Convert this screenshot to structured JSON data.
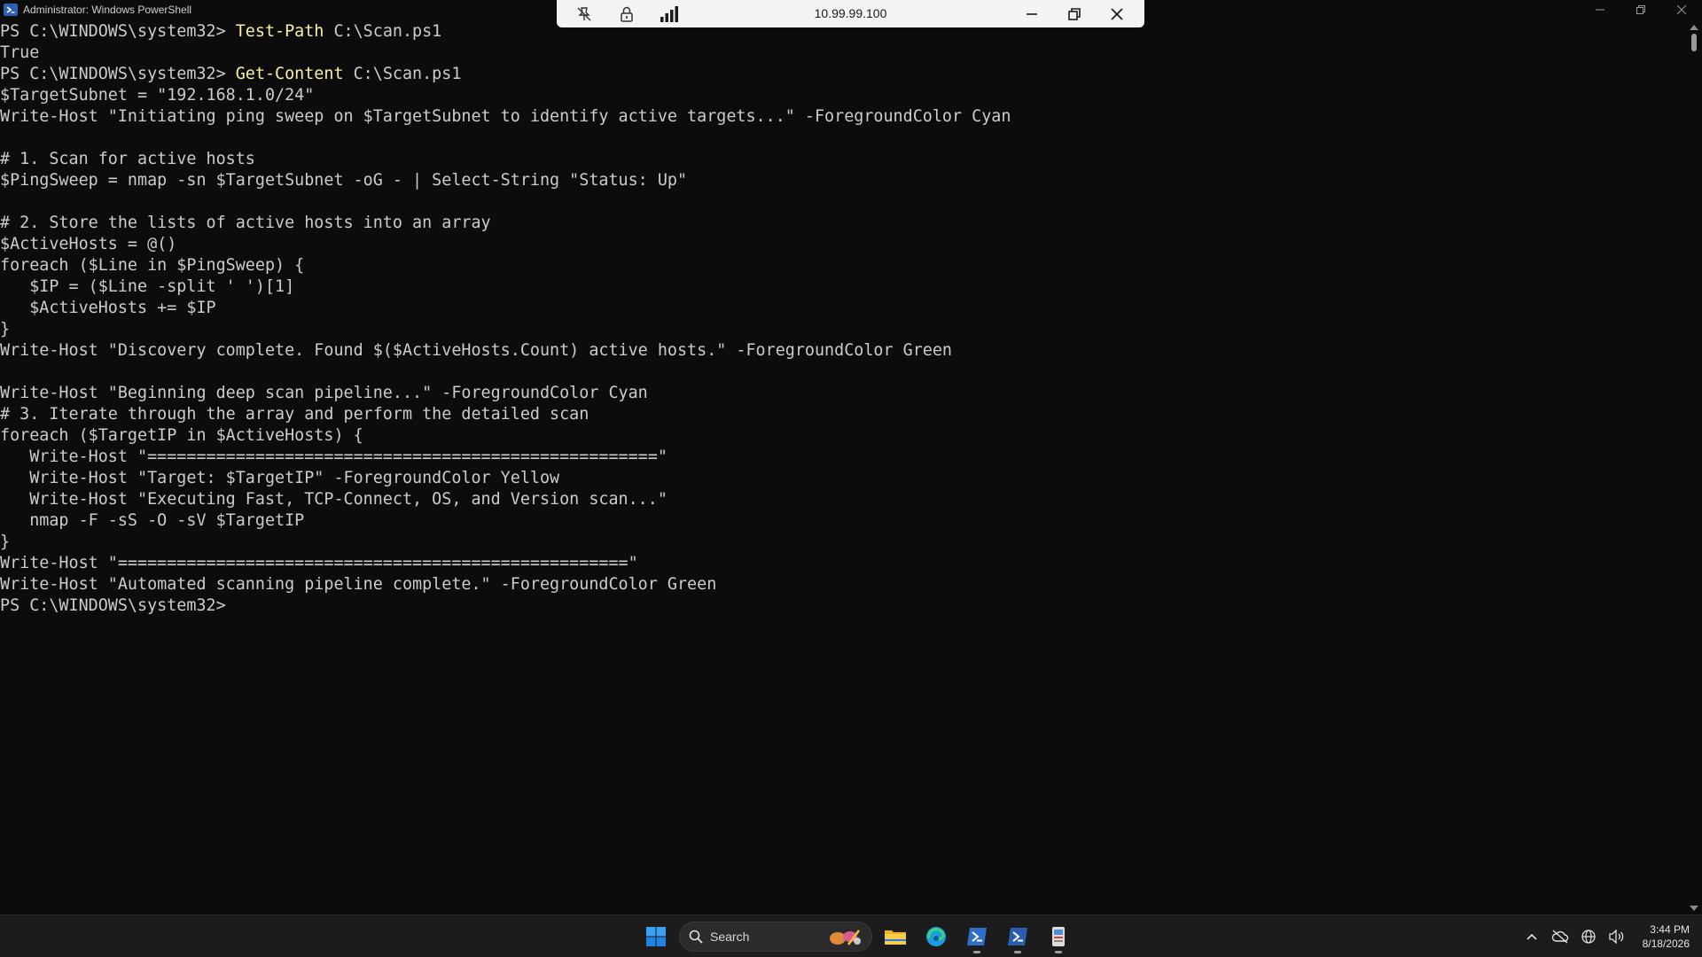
{
  "window": {
    "title": "Administrator: Windows PowerShell"
  },
  "rdp": {
    "host": "10.99.99.100"
  },
  "terminal": {
    "lines": [
      {
        "prompt": "PS C:\\WINDOWS\\system32> ",
        "cmd": "Test-Path",
        "arg": " C:\\Scan.ps1"
      },
      {
        "text": "True"
      },
      {
        "prompt": "PS C:\\WINDOWS\\system32> ",
        "cmd": "Get-Content",
        "arg": " C:\\Scan.ps1"
      },
      {
        "text": "$TargetSubnet = \"192.168.1.0/24\""
      },
      {
        "text": "Write-Host \"Initiating ping sweep on $TargetSubnet to identify active targets...\" -ForegroundColor Cyan"
      },
      {
        "text": ""
      },
      {
        "text": "# 1. Scan for active hosts"
      },
      {
        "text": "$PingSweep = nmap -sn $TargetSubnet -oG - | Select-String \"Status: Up\""
      },
      {
        "text": ""
      },
      {
        "text": "# 2. Store the lists of active hosts into an array"
      },
      {
        "text": "$ActiveHosts = @()"
      },
      {
        "text": "foreach ($Line in $PingSweep) {"
      },
      {
        "text": "   $IP = ($Line -split ' ')[1]"
      },
      {
        "text": "   $ActiveHosts += $IP"
      },
      {
        "text": "}"
      },
      {
        "text": "Write-Host \"Discovery complete. Found $($ActiveHosts.Count) active hosts.\" -ForegroundColor Green"
      },
      {
        "text": ""
      },
      {
        "text": "Write-Host \"Beginning deep scan pipeline...\" -ForegroundColor Cyan"
      },
      {
        "text": "# 3. Iterate through the array and perform the detailed scan"
      },
      {
        "text": "foreach ($TargetIP in $ActiveHosts) {"
      },
      {
        "text": "   Write-Host \"====================================================\""
      },
      {
        "text": "   Write-Host \"Target: $TargetIP\" -ForegroundColor Yellow"
      },
      {
        "text": "   Write-Host \"Executing Fast, TCP-Connect, OS, and Version scan...\""
      },
      {
        "text": "   nmap -F -sS -O -sV $TargetIP"
      },
      {
        "text": "}"
      },
      {
        "text": "Write-Host \"====================================================\""
      },
      {
        "text": "Write-Host \"Automated scanning pipeline complete.\" -ForegroundColor Green"
      },
      {
        "prompt": "PS C:\\WINDOWS\\system32> ",
        "cmd": "",
        "arg": ""
      }
    ]
  },
  "taskbar": {
    "search_label": "Search",
    "time": "3:44 PM",
    "date": "8/18/2026"
  },
  "colors": {
    "terminal_bg": "#0c0c0c",
    "terminal_fg": "#cccccc",
    "command_yellow": "#f9f1a5",
    "taskbar_bg": "#1c1c1c",
    "accent_blue": "#0078d4"
  }
}
